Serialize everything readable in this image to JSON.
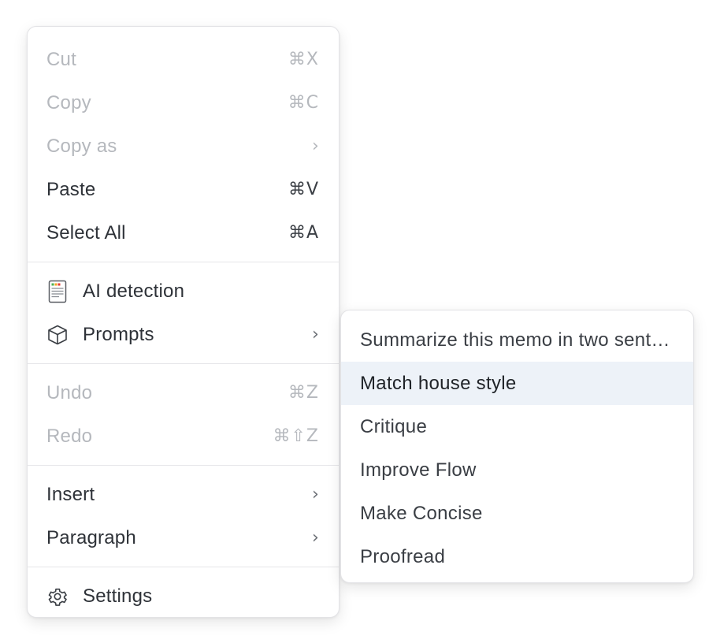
{
  "main_menu": {
    "group_edit": [
      {
        "label": "Cut",
        "shortcut": "⌘X",
        "disabled": true
      },
      {
        "label": "Copy",
        "shortcut": "⌘C",
        "disabled": true
      },
      {
        "label": "Copy as",
        "chevron": "›",
        "disabled": true
      },
      {
        "label": "Paste",
        "shortcut": "⌘V",
        "disabled": false
      },
      {
        "label": "Select All",
        "shortcut": "⌘A",
        "disabled": false
      }
    ],
    "group_ai": [
      {
        "label": "AI detection",
        "icon": "ai-detection-icon"
      },
      {
        "label": "Prompts",
        "icon": "cube-icon",
        "chevron": "›"
      }
    ],
    "group_history": [
      {
        "label": "Undo",
        "shortcut": "⌘Z",
        "disabled": true
      },
      {
        "label": "Redo",
        "shortcut": "⌘⇧Z",
        "disabled": true
      }
    ],
    "group_format": [
      {
        "label": "Insert",
        "chevron": "›"
      },
      {
        "label": "Paragraph",
        "chevron": "›"
      }
    ],
    "group_settings": [
      {
        "label": "Settings",
        "icon": "gear-icon"
      }
    ]
  },
  "prompts_submenu": {
    "items": [
      {
        "label": "Summarize this memo in two sentences"
      },
      {
        "label": "Match house style",
        "highlighted": true
      },
      {
        "label": "Critique"
      },
      {
        "label": "Improve Flow"
      },
      {
        "label": "Make Concise"
      },
      {
        "label": "Proofread"
      }
    ]
  },
  "colors": {
    "text": "#2e3238",
    "disabled_text": "#b5b8bd",
    "highlight_bg": "#edf2f8",
    "divider": "#e6e6e9"
  }
}
